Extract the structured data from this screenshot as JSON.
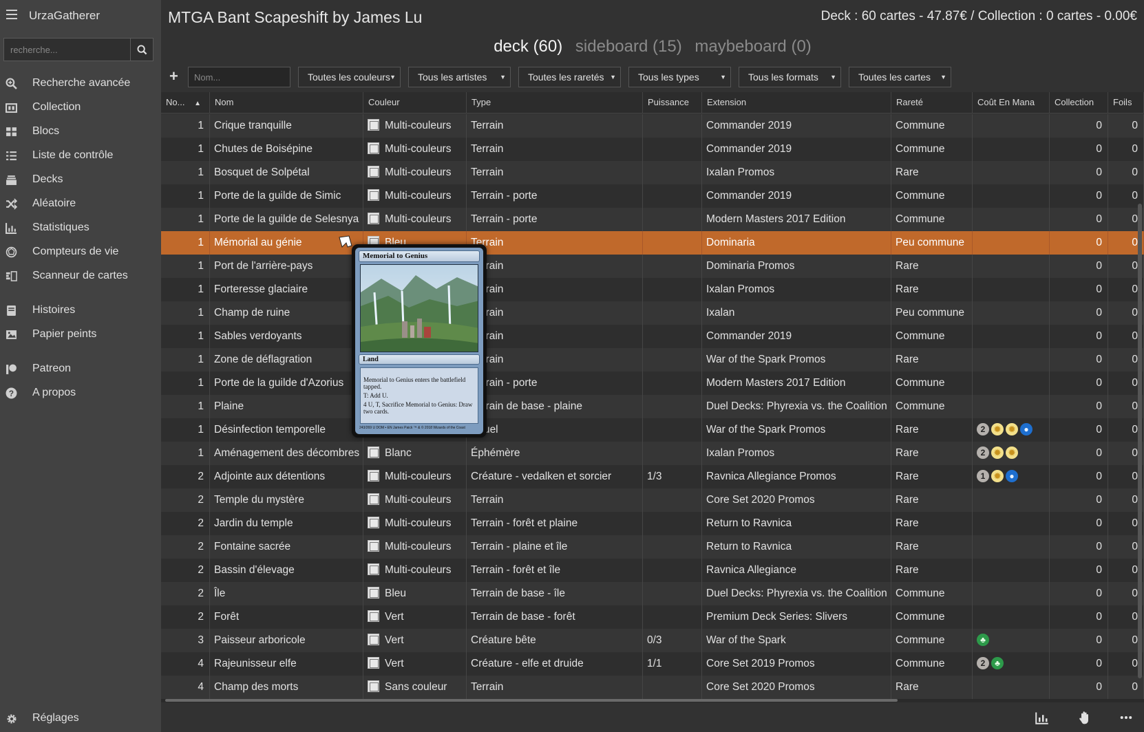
{
  "app": {
    "title": "UrzaGatherer"
  },
  "search": {
    "placeholder": "recherche..."
  },
  "nav": [
    {
      "label": "Recherche avancée",
      "icon": "zoom-in-icon"
    },
    {
      "label": "Collection",
      "icon": "collection-icon"
    },
    {
      "label": "Blocs",
      "icon": "grid-icon"
    },
    {
      "label": "Liste de contrôle",
      "icon": "checklist-icon"
    },
    {
      "label": "Decks",
      "icon": "cards-stack-icon"
    },
    {
      "label": "Aléatoire",
      "icon": "shuffle-icon"
    },
    {
      "label": "Statistiques",
      "icon": "bar-chart-icon"
    },
    {
      "label": "Compteurs de vie",
      "icon": "life-counter-icon"
    },
    {
      "label": "Scanneur de cartes",
      "icon": "scanner-icon"
    },
    {
      "label": "Histoires",
      "icon": "book-icon"
    },
    {
      "label": "Papier peints",
      "icon": "image-icon"
    },
    {
      "label": "Patreon",
      "icon": "patreon-icon"
    },
    {
      "label": "A propos",
      "icon": "help-icon"
    }
  ],
  "settings": {
    "label": "Réglages"
  },
  "deck": {
    "title": "MTGA Bant Scapeshift by James Lu",
    "summary": "Deck : 60 cartes - 47.87€ / Collection : 0 cartes - 0.00€"
  },
  "tabs": [
    {
      "label": "deck (60)",
      "active": true
    },
    {
      "label": "sideboard (15)",
      "active": false
    },
    {
      "label": "maybeboard (0)",
      "active": false
    }
  ],
  "filters": {
    "add_symbol": "+",
    "name_placeholder": "Nom...",
    "dropdowns": [
      "Toutes les couleurs",
      "Tous les artistes",
      "Toutes les raretés",
      "Tous les types",
      "Tous les formats",
      "Toutes les cartes"
    ]
  },
  "columns": [
    "No...",
    "Nom",
    "Couleur",
    "Type",
    "Puissance",
    "Extension",
    "Rareté",
    "Coût En Mana",
    "Collection",
    "Foils"
  ],
  "sort_indicator": "▲",
  "rows": [
    {
      "qty": "1",
      "name": "Crique tranquille",
      "color": "Multi-couleurs",
      "type": "Terrain",
      "power": "",
      "set": "Commander 2019",
      "rarity": "Commune",
      "mana": [],
      "coll": "0",
      "foils": "0"
    },
    {
      "qty": "1",
      "name": "Chutes de Boisépine",
      "color": "Multi-couleurs",
      "type": "Terrain",
      "power": "",
      "set": "Commander 2019",
      "rarity": "Commune",
      "mana": [],
      "coll": "0",
      "foils": "0"
    },
    {
      "qty": "1",
      "name": "Bosquet de Solpétal",
      "color": "Multi-couleurs",
      "type": "Terrain",
      "power": "",
      "set": "Ixalan Promos",
      "rarity": "Rare",
      "mana": [],
      "coll": "0",
      "foils": "0"
    },
    {
      "qty": "1",
      "name": "Porte de la guilde de Simic",
      "color": "Multi-couleurs",
      "type": "Terrain - porte",
      "power": "",
      "set": "Commander 2019",
      "rarity": "Commune",
      "mana": [],
      "coll": "0",
      "foils": "0"
    },
    {
      "qty": "1",
      "name": "Porte de la guilde de Selesnya",
      "color": "Multi-couleurs",
      "type": "Terrain - porte",
      "power": "",
      "set": "Modern Masters 2017 Edition",
      "rarity": "Commune",
      "mana": [],
      "coll": "0",
      "foils": "0"
    },
    {
      "qty": "1",
      "name": "Mémorial au génie",
      "color": "Bleu",
      "type": "Terrain",
      "power": "",
      "set": "Dominaria",
      "rarity": "Peu commune",
      "mana": [],
      "coll": "0",
      "foils": "0",
      "selected": true
    },
    {
      "qty": "1",
      "name": "Port de l'arrière-pays",
      "color": "Multi-couleurs",
      "type": "Terrain",
      "power": "",
      "set": "Dominaria Promos",
      "rarity": "Rare",
      "mana": [],
      "coll": "0",
      "foils": "0"
    },
    {
      "qty": "1",
      "name": "Forteresse glaciaire",
      "color": "Multi-couleurs",
      "type": "Terrain",
      "power": "",
      "set": "Ixalan Promos",
      "rarity": "Rare",
      "mana": [],
      "coll": "0",
      "foils": "0"
    },
    {
      "qty": "1",
      "name": "Champ de ruine",
      "color": "Sans couleur",
      "type": "Terrain",
      "power": "",
      "set": "Ixalan",
      "rarity": "Peu commune",
      "mana": [],
      "coll": "0",
      "foils": "0"
    },
    {
      "qty": "1",
      "name": "Sables verdoyants",
      "color": "Sans couleur",
      "type": "Terrain",
      "power": "",
      "set": "Commander 2019",
      "rarity": "Commune",
      "mana": [],
      "coll": "0",
      "foils": "0"
    },
    {
      "qty": "1",
      "name": "Zone de déflagration",
      "color": "Sans couleur",
      "type": "Terrain",
      "power": "",
      "set": "War of the Spark Promos",
      "rarity": "Rare",
      "mana": [],
      "coll": "0",
      "foils": "0"
    },
    {
      "qty": "1",
      "name": "Porte de la guilde d'Azorius",
      "color": "Multi-couleurs",
      "type": "Terrain - porte",
      "power": "",
      "set": "Modern Masters 2017 Edition",
      "rarity": "Commune",
      "mana": [],
      "coll": "0",
      "foils": "0"
    },
    {
      "qty": "1",
      "name": "Plaine",
      "color": "Blanc",
      "type": "Terrain de base - plaine",
      "power": "",
      "set": "Duel Decks: Phyrexia vs. the Coalition",
      "rarity": "Commune",
      "mana": [],
      "coll": "0",
      "foils": "0"
    },
    {
      "qty": "1",
      "name": "Désinfection temporelle",
      "color": "Multi-couleurs",
      "type": "Rituel",
      "power": "",
      "set": "War of the Spark Promos",
      "rarity": "Rare",
      "mana": [
        "2",
        "W",
        "W",
        "U"
      ],
      "coll": "0",
      "foils": "0"
    },
    {
      "qty": "1",
      "name": "Aménagement des décombres",
      "color": "Blanc",
      "type": "Éphémère",
      "power": "",
      "set": "Ixalan Promos",
      "rarity": "Rare",
      "mana": [
        "2",
        "W",
        "W"
      ],
      "coll": "0",
      "foils": "0"
    },
    {
      "qty": "2",
      "name": "Adjointe aux détentions",
      "color": "Multi-couleurs",
      "type": "Créature - vedalken et sorcier",
      "power": "1/3",
      "set": "Ravnica Allegiance Promos",
      "rarity": "Rare",
      "mana": [
        "1",
        "W",
        "U"
      ],
      "coll": "0",
      "foils": "0"
    },
    {
      "qty": "2",
      "name": "Temple du mystère",
      "color": "Multi-couleurs",
      "type": "Terrain",
      "power": "",
      "set": "Core Set 2020 Promos",
      "rarity": "Rare",
      "mana": [],
      "coll": "0",
      "foils": "0"
    },
    {
      "qty": "2",
      "name": "Jardin du temple",
      "color": "Multi-couleurs",
      "type": "Terrain - forêt et plaine",
      "power": "",
      "set": "Return to Ravnica",
      "rarity": "Rare",
      "mana": [],
      "coll": "0",
      "foils": "0"
    },
    {
      "qty": "2",
      "name": "Fontaine sacrée",
      "color": "Multi-couleurs",
      "type": "Terrain - plaine et île",
      "power": "",
      "set": "Return to Ravnica",
      "rarity": "Rare",
      "mana": [],
      "coll": "0",
      "foils": "0"
    },
    {
      "qty": "2",
      "name": "Bassin d'élevage",
      "color": "Multi-couleurs",
      "type": "Terrain - forêt et île",
      "power": "",
      "set": "Ravnica Allegiance",
      "rarity": "Rare",
      "mana": [],
      "coll": "0",
      "foils": "0"
    },
    {
      "qty": "2",
      "name": "Île",
      "color": "Bleu",
      "type": "Terrain de base - île",
      "power": "",
      "set": "Duel Decks: Phyrexia vs. the Coalition",
      "rarity": "Commune",
      "mana": [],
      "coll": "0",
      "foils": "0"
    },
    {
      "qty": "2",
      "name": "Forêt",
      "color": "Vert",
      "type": "Terrain de base - forêt",
      "power": "",
      "set": "Premium Deck Series: Slivers",
      "rarity": "Commune",
      "mana": [],
      "coll": "0",
      "foils": "0"
    },
    {
      "qty": "3",
      "name": "Paisseur arboricole",
      "color": "Vert",
      "type": "Créature bête",
      "power": "0/3",
      "set": "War of the Spark",
      "rarity": "Commune",
      "mana": [
        "G"
      ],
      "coll": "0",
      "foils": "0"
    },
    {
      "qty": "4",
      "name": "Rajeunisseur elfe",
      "color": "Vert",
      "type": "Créature - elfe et druide",
      "power": "1/1",
      "set": "Core Set 2019 Promos",
      "rarity": "Commune",
      "mana": [
        "2",
        "G"
      ],
      "coll": "0",
      "foils": "0"
    },
    {
      "qty": "4",
      "name": "Champ des morts",
      "color": "Sans couleur",
      "type": "Terrain",
      "power": "",
      "set": "Core Set 2020 Promos",
      "rarity": "Rare",
      "mana": [],
      "coll": "0",
      "foils": "0"
    }
  ],
  "card_popup": {
    "name": "Memorial to Genius",
    "type_line": "Land",
    "text1": "Memorial to Genius enters the battlefield tapped.",
    "text2": "T: Add U.",
    "text3": "4 U, T, Sacrifice Memorial to Genius: Draw two cards.",
    "footer": "243/269 U  DOM • EN  James Paick  ™ & © 2018 Wizards of the Coast"
  },
  "colors": {
    "sidebar_bg": "#424242",
    "main_bg": "#323232",
    "selected_row": "#c0692b",
    "mana_white": "#f3e08a",
    "mana_blue": "#1e6fcf",
    "mana_green": "#2d9a4a",
    "mana_generic": "#b5b1ad"
  }
}
